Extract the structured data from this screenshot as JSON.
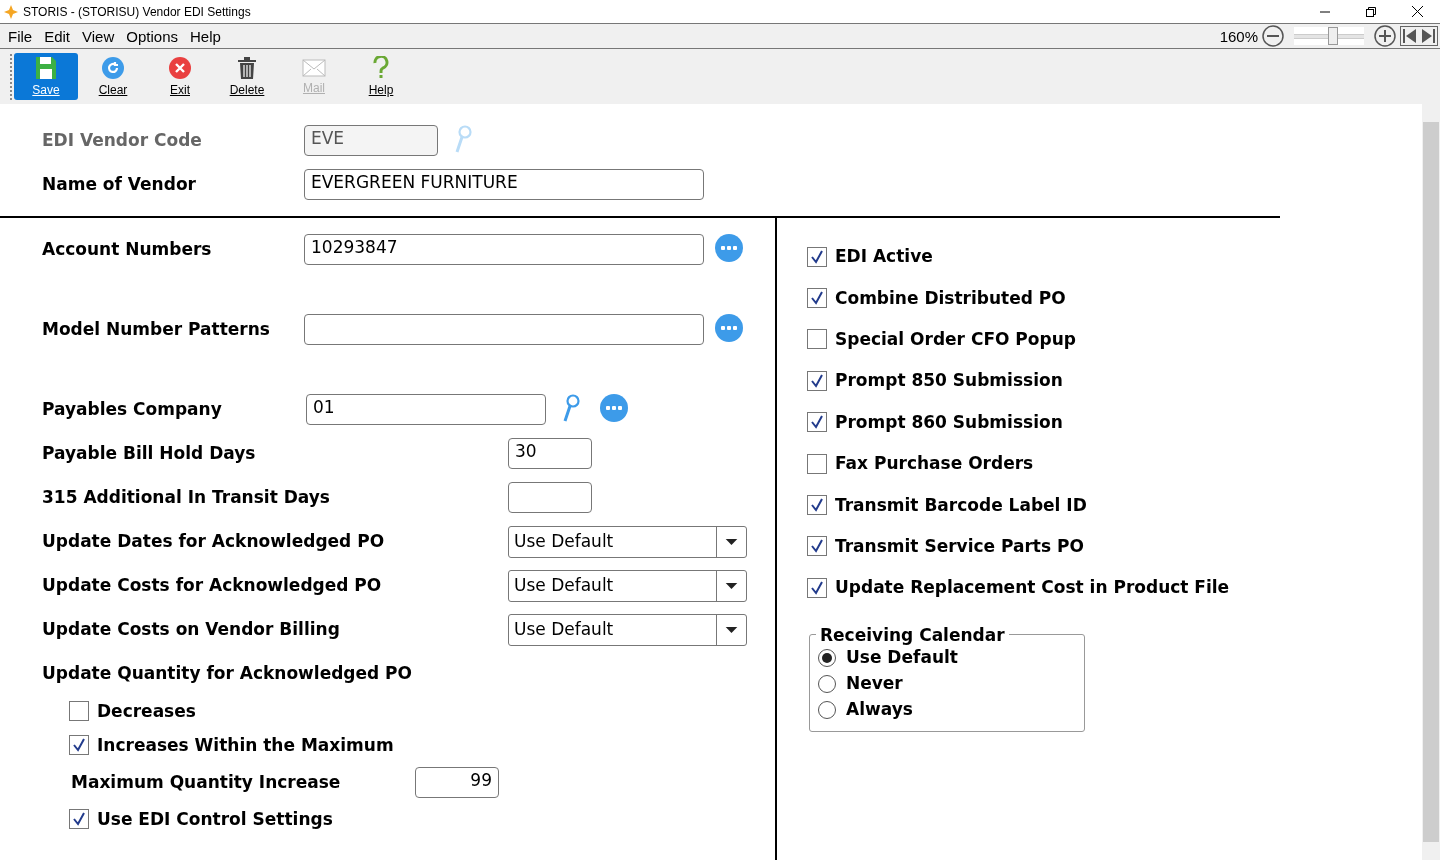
{
  "window": {
    "title": "STORIS - (STORISU) Vendor EDI Settings"
  },
  "menu": [
    "File",
    "Edit",
    "View",
    "Options",
    "Help"
  ],
  "zoom": {
    "reading": "160%",
    "level": 0.55
  },
  "toolbar": [
    {
      "label": "Save",
      "kind": "save",
      "disabled": false,
      "highlighted": true
    },
    {
      "label": "Clear",
      "kind": "clear",
      "disabled": false,
      "highlighted": false
    },
    {
      "label": "Exit",
      "kind": "exit",
      "disabled": false,
      "highlighted": false
    },
    {
      "label": "Delete",
      "kind": "delete",
      "disabled": false,
      "highlighted": false
    },
    {
      "label": "Mail",
      "kind": "mail",
      "disabled": true,
      "highlighted": false
    },
    {
      "label": "Help",
      "kind": "help",
      "disabled": false,
      "highlighted": false
    }
  ],
  "header": [
    {
      "label": "EDI Vendor Code",
      "value": "EVE",
      "disabled": true,
      "lookup": true
    },
    {
      "label": "Name of Vendor",
      "value": "EVERGREEN FURNITURE",
      "disabled": false,
      "lookup": false
    }
  ],
  "left": [
    {
      "kind": "list-field",
      "label": "Account Numbers",
      "value": "10293847"
    },
    {
      "kind": "list-field",
      "label": "Model Number Patterns"
    },
    {
      "kind": "lookup-field",
      "label": "Payables Company",
      "value": "01"
    },
    {
      "kind": "number-field",
      "label": "Payable Bill Hold Days",
      "value": "30"
    },
    {
      "kind": "number-field",
      "label": "315 Additional In Transit Days"
    },
    {
      "kind": "dropdown",
      "label": "Update Dates for Acknowledged PO",
      "value": "Use Default"
    },
    {
      "kind": "dropdown",
      "label": "Update Costs for Acknowledged PO",
      "value": "Use Default"
    },
    {
      "kind": "dropdown",
      "label": "Update Costs on Vendor Billing",
      "value": "Use Default"
    },
    {
      "kind": "heading",
      "label": "Update Quantity for Acknowledged PO"
    },
    {
      "kind": "checkbox",
      "label": "Decreases",
      "checked": false
    },
    {
      "kind": "checkbox",
      "label": "Increases Within the Maximum",
      "checked": true
    },
    {
      "kind": "indented-number",
      "label": "Maximum Quantity Increase",
      "value": "99"
    },
    {
      "kind": "checkbox",
      "label": "Use EDI Control Settings",
      "checked": true
    }
  ],
  "options": [
    {
      "label": "EDI Active",
      "checked": true
    },
    {
      "label": "Combine Distributed PO",
      "checked": true
    },
    {
      "label": "Special Order CFO Popup",
      "checked": false
    },
    {
      "label": "Prompt 850 Submission",
      "checked": true
    },
    {
      "label": "Prompt 860 Submission",
      "checked": true
    },
    {
      "label": "Fax Purchase Orders",
      "checked": false
    },
    {
      "label": "Transmit Barcode Label ID",
      "checked": true
    },
    {
      "label": "Transmit Service Parts PO",
      "checked": true
    },
    {
      "label": "Update Replacement Cost in Product File",
      "checked": true
    }
  ],
  "receiving_calendar": {
    "title": "Receiving Calendar",
    "options": [
      {
        "label": "Use Default",
        "selected": true
      },
      {
        "label": "Never",
        "selected": false
      },
      {
        "label": "Always",
        "selected": false
      }
    ]
  }
}
